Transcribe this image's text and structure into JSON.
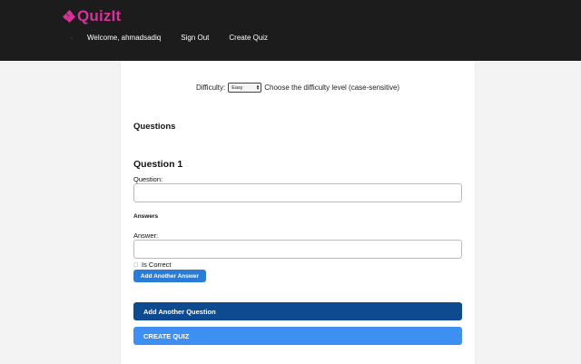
{
  "header": {
    "logo_text": "QuizIt",
    "nav": [
      {
        "label": "Welcome, ahmadsadiq"
      },
      {
        "label": "Sign Out"
      },
      {
        "label": "Create Quiz"
      }
    ]
  },
  "form": {
    "difficulty_label": "Difficulty:",
    "difficulty_value": "Easy",
    "difficulty_hint": "Choose the difficulty level (case-sensitive)",
    "questions_heading": "Questions",
    "question_title": "Question 1",
    "question_label": "Question:",
    "question_value": "",
    "answers_heading": "Answers",
    "answer_label": "Answer:",
    "answer_value": "",
    "is_correct_label": "Is Correct",
    "add_answer_label": "Add Another Answer",
    "add_question_label": "Add Another Question",
    "create_label": "CREATE QUIZ"
  },
  "colors": {
    "brand": "#d8329a",
    "topbar": "#1c1c1c",
    "add_answer_button": "#2b7bd8",
    "add_question_button": "#0e4a8f",
    "create_button": "#3d8ff2"
  }
}
